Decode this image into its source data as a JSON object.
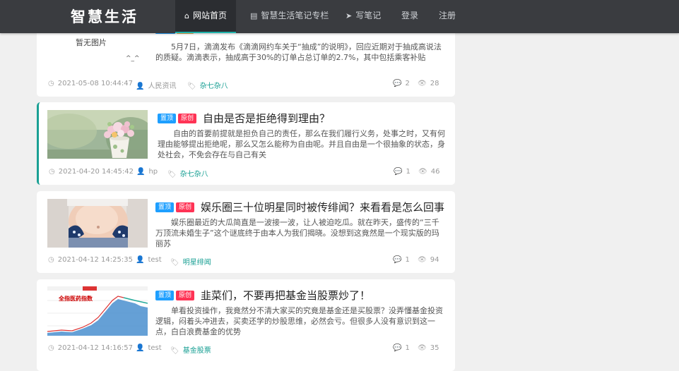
{
  "nav": {
    "logo": "智慧生活",
    "items": [
      {
        "label": "网站首页",
        "icon": "home-icon",
        "glyph": "⌂",
        "active": true
      },
      {
        "label": "智慧生活笔记专栏",
        "icon": "document-icon",
        "glyph": "▤",
        "active": false
      },
      {
        "label": "写笔记",
        "icon": "paper-plane-icon",
        "glyph": "➤",
        "active": false
      },
      {
        "label": "登录",
        "icon": "",
        "glyph": "",
        "active": false
      },
      {
        "label": "注册",
        "icon": "",
        "glyph": "",
        "active": false
      }
    ]
  },
  "posts": [
    {
      "thumb_text": "暂无图片",
      "thumb_face": "^_^",
      "summary": "5月7日，滴滴发布《滴滴网约车关于“抽成”的说明》，回应近期对于抽成高说法的质疑。滴滴表示，抽成高于30%的订单占总订单的2.7%，其中包括乘客补贴",
      "date": "2021-05-08 10:44:47",
      "author": "人民资讯",
      "category": "杂七杂八",
      "comments": "2",
      "views": "28"
    },
    {
      "badge_top": "置顶",
      "badge_orig": "原创",
      "title": "自由是否是拒绝得到理由？",
      "summary": "自由的首要前提就是担负自己的责任，那么在我们履行义务，处事之时，又有何理由能够提出拒绝呢，那么又怎么能称为自由呢。并且自由是一个很抽象的状态，身处社会，不免会存在与自己有关",
      "date": "2021-04-20 14:45:42",
      "author": "hp",
      "category": "杂七杂八",
      "comments": "1",
      "views": "46"
    },
    {
      "badge_top": "置顶",
      "badge_orig": "原创",
      "title": "娱乐圈三十位明星同时被传绯闻？来看看是怎么回事",
      "summary": "娱乐圈最近的大瓜简直是一波接一波，让人被迫吃瓜。就在昨天，盛传的“三千万顶流未婚生子”这个谜底终于由本人为我们揭晓。没想到这竟然是一个现实版的玛丽苏",
      "date": "2021-04-12 14:25:35",
      "author": "test",
      "category": "明星绯闻",
      "comments": "1",
      "views": "94"
    },
    {
      "badge_top": "置顶",
      "badge_orig": "原创",
      "title": "韭菜们，不要再把基金当股票炒了！",
      "summary": "单看投资操作，我竟然分不清大家买的究竟是基金还是买股票？没弄懂基金投资逻辑，闷着头冲进去，买卖还学的炒股思维，必然会亏。但很多人没有意识到这一点，白白浪费基金的优势",
      "thumb_text": "全指医药指数",
      "date": "2021-04-12 14:16:57",
      "author": "test",
      "category": "基金股票",
      "comments": "1",
      "views": "35"
    }
  ]
}
